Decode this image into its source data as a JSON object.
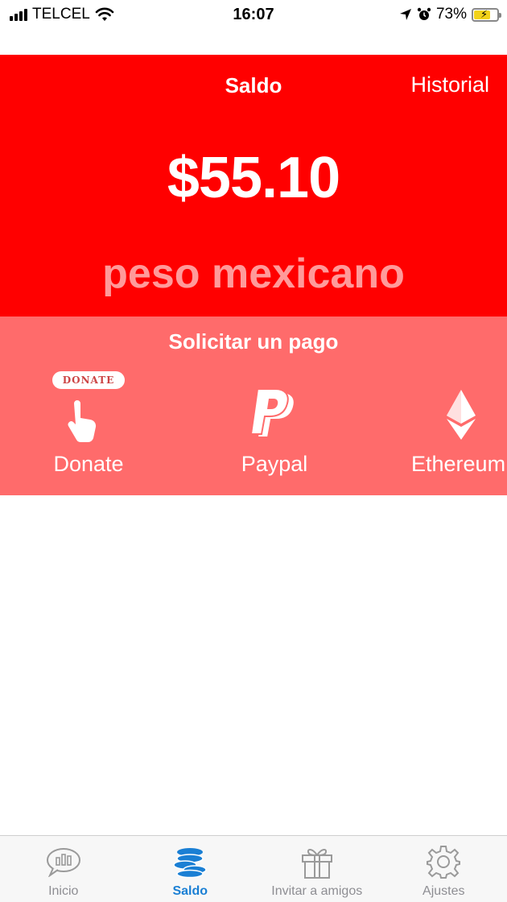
{
  "status_bar": {
    "carrier": "TELCEL",
    "time": "16:07",
    "battery": "73%",
    "battery_level": 0.73
  },
  "balance": {
    "title": "Saldo",
    "history_label": "Historial",
    "amount": "$55.10",
    "currency": "peso mexicano"
  },
  "request": {
    "title": "Solicitar un pago",
    "methods": [
      {
        "label": "Donate",
        "icon": "donate-hand-icon",
        "badge": "DONATE"
      },
      {
        "label": "Paypal",
        "icon": "paypal-icon"
      },
      {
        "label": "Ethereum",
        "icon": "ethereum-icon"
      }
    ]
  },
  "colors": {
    "primary_red": "#ff0000",
    "light_red": "#ff6b6b",
    "tab_active": "#1a7fd4",
    "tab_inactive": "#8e8e93"
  },
  "tab_bar": {
    "active_index": 1,
    "items": [
      {
        "label": "Inicio",
        "icon": "chart-bubble-icon"
      },
      {
        "label": "Saldo",
        "icon": "coins-icon"
      },
      {
        "label": "Invitar a amigos",
        "icon": "gift-icon"
      },
      {
        "label": "Ajustes",
        "icon": "gear-icon"
      }
    ]
  }
}
